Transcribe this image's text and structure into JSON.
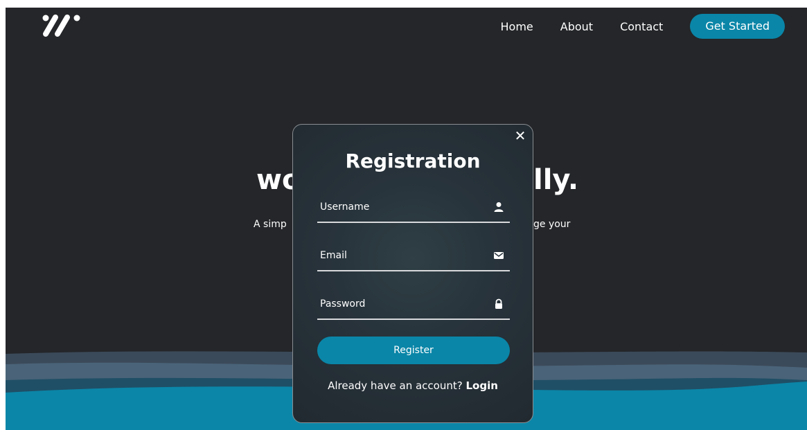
{
  "nav": {
    "items": [
      {
        "label": "Home"
      },
      {
        "label": "About"
      },
      {
        "label": "Contact"
      }
    ],
    "cta_label": "Get Started"
  },
  "hero": {
    "title_left": "wo",
    "title_right": "lly.",
    "subtitle_left": "A simp",
    "subtitle_right": "ge your"
  },
  "modal": {
    "title": "Registration",
    "fields": {
      "username": {
        "placeholder": "Username",
        "icon": "user-icon"
      },
      "email": {
        "placeholder": "Email",
        "icon": "envelope-icon"
      },
      "password": {
        "placeholder": "Password",
        "icon": "lock-icon"
      }
    },
    "register_label": "Register",
    "login_prompt": "Already have an account?",
    "login_link": "Login",
    "close_glyph": "✕"
  },
  "colors": {
    "background": "#242629",
    "accent": "#0a86a8",
    "wave_dark": "#3b4a5a",
    "wave_mid": "#4a6378"
  }
}
